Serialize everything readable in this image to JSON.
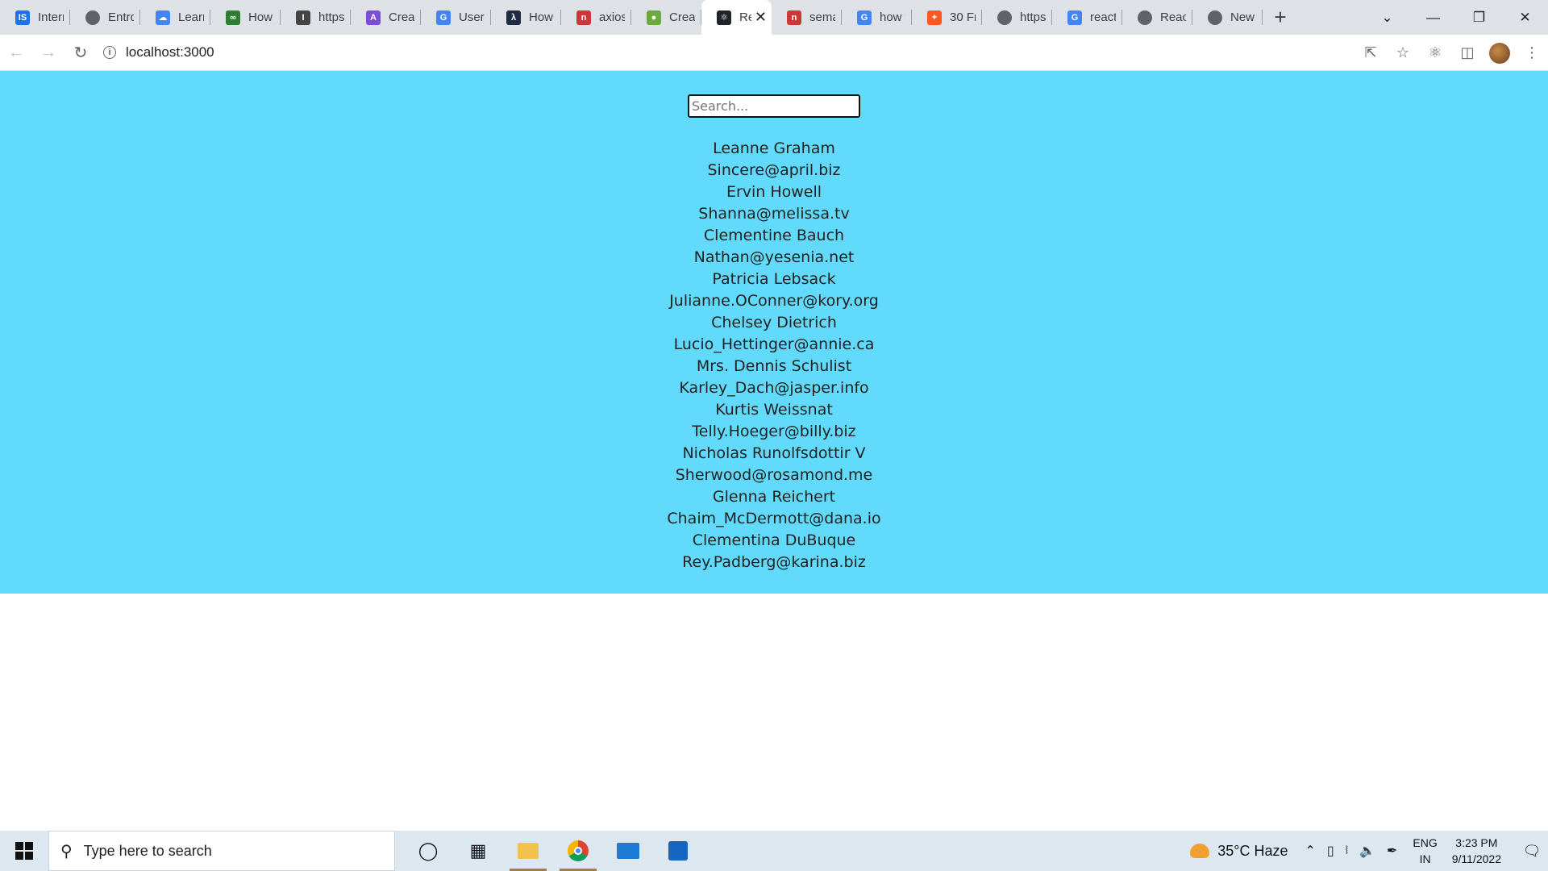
{
  "browser": {
    "tabs": [
      {
        "title": "Intern",
        "favicon": "is-icon",
        "color": "#1a73e8",
        "glyph": "IS"
      },
      {
        "title": "Entro",
        "favicon": "globe-icon",
        "color": "#5f6368",
        "glyph": ""
      },
      {
        "title": "Learn",
        "favicon": "cloud-icon",
        "color": "#4285f4",
        "glyph": "☁"
      },
      {
        "title": "How t",
        "favicon": "link-icon",
        "color": "#2e7d32",
        "glyph": "∞"
      },
      {
        "title": "https:",
        "favicon": "io-icon",
        "color": "#444444",
        "glyph": "I"
      },
      {
        "title": "Creat",
        "favicon": "vite-icon",
        "color": "#7b4ddb",
        "glyph": "A"
      },
      {
        "title": "User c",
        "favicon": "google-icon",
        "color": "#4285f4",
        "glyph": "G"
      },
      {
        "title": "How t",
        "favicon": "codecademy-icon",
        "color": "#1f2a44",
        "glyph": "λ"
      },
      {
        "title": "axios",
        "favicon": "npm-icon",
        "color": "#cb3837",
        "glyph": "n"
      },
      {
        "title": "Creat",
        "favicon": "leaf-icon",
        "color": "#6bab3d",
        "glyph": "●"
      },
      {
        "title": "Re",
        "favicon": "react-icon",
        "color": "#20232a",
        "glyph": "⚛",
        "active": true
      },
      {
        "title": "sema",
        "favicon": "npm-icon",
        "color": "#cb3837",
        "glyph": "n"
      },
      {
        "title": "how t",
        "favicon": "google-icon",
        "color": "#4285f4",
        "glyph": "G"
      },
      {
        "title": "30 Fr",
        "favicon": "fire-icon",
        "color": "#ff5722",
        "glyph": "✦"
      },
      {
        "title": "https:",
        "favicon": "globe-icon",
        "color": "#5f6368",
        "glyph": ""
      },
      {
        "title": "react",
        "favicon": "google-icon",
        "color": "#4285f4",
        "glyph": "G"
      },
      {
        "title": "React",
        "favicon": "globe-icon",
        "color": "#5f6368",
        "glyph": ""
      },
      {
        "title": "New",
        "favicon": "chrome-icon",
        "color": "#5f6368",
        "glyph": ""
      }
    ],
    "url": "localhost:3000"
  },
  "app": {
    "background": "#61dafb",
    "search_placeholder": "Search...",
    "users": [
      {
        "name": "Leanne Graham",
        "email": "Sincere@april.biz"
      },
      {
        "name": "Ervin Howell",
        "email": "Shanna@melissa.tv"
      },
      {
        "name": "Clementine Bauch",
        "email": "Nathan@yesenia.net"
      },
      {
        "name": "Patricia Lebsack",
        "email": "Julianne.OConner@kory.org"
      },
      {
        "name": "Chelsey Dietrich",
        "email": "Lucio_Hettinger@annie.ca"
      },
      {
        "name": "Mrs. Dennis Schulist",
        "email": "Karley_Dach@jasper.info"
      },
      {
        "name": "Kurtis Weissnat",
        "email": "Telly.Hoeger@billy.biz"
      },
      {
        "name": "Nicholas Runolfsdottir V",
        "email": "Sherwood@rosamond.me"
      },
      {
        "name": "Glenna Reichert",
        "email": "Chaim_McDermott@dana.io"
      },
      {
        "name": "Clementina DuBuque",
        "email": "Rey.Padberg@karina.biz"
      }
    ]
  },
  "taskbar": {
    "search_placeholder": "Type here to search",
    "weather": "35°C  Haze",
    "lang_top": "ENG",
    "lang_bottom": "IN",
    "time": "3:23 PM",
    "date": "9/11/2022"
  }
}
